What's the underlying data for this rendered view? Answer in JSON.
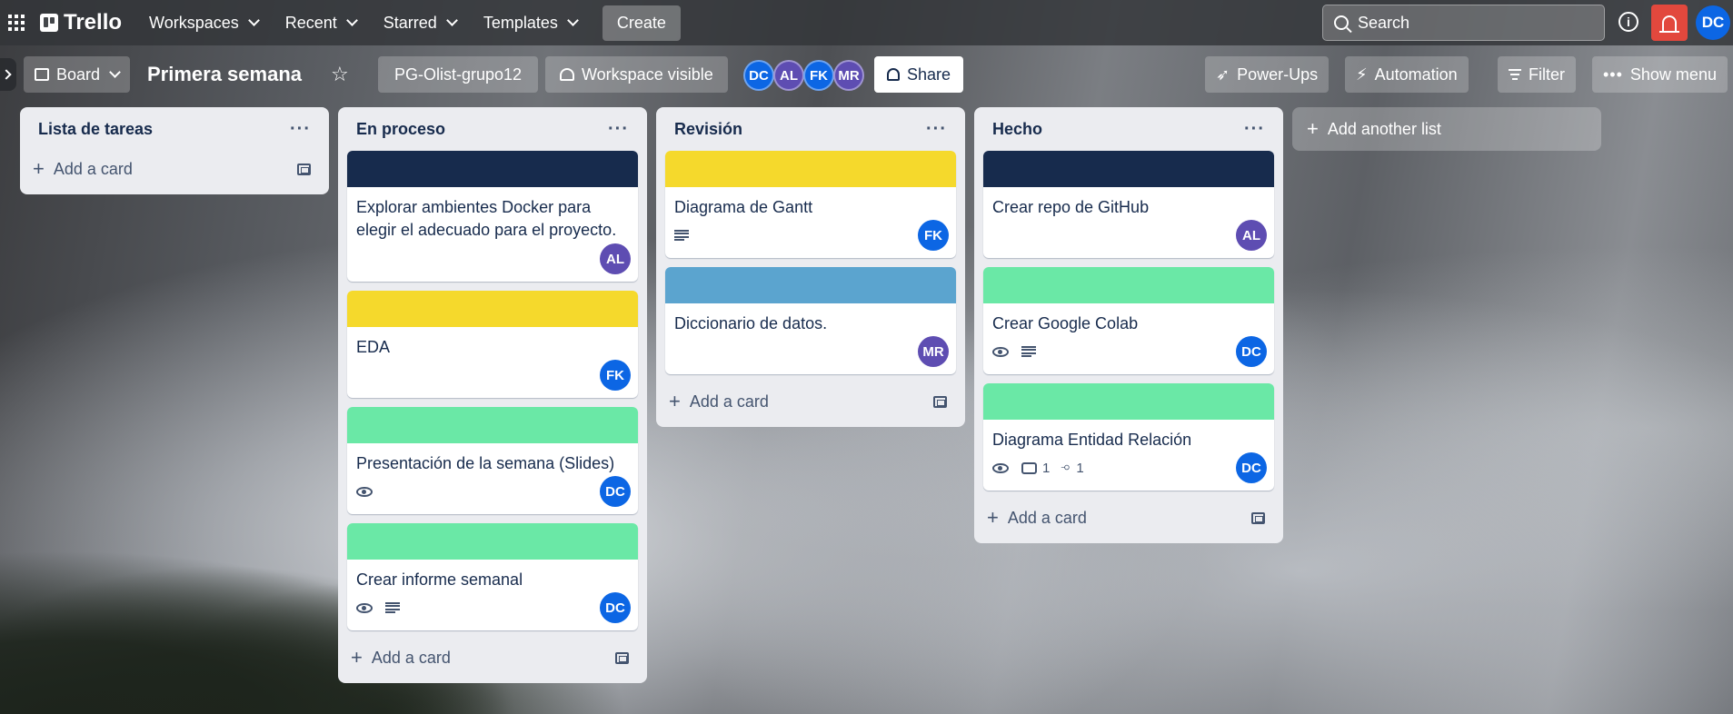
{
  "topnav": {
    "brand": "Trello",
    "menus": [
      "Workspaces",
      "Recent",
      "Starred",
      "Templates"
    ],
    "create_label": "Create",
    "search_placeholder": "Search",
    "user_initials": "DC"
  },
  "board": {
    "view_label": "Board",
    "title": "Primera semana",
    "workspace": "PG-Olist-grupo12",
    "visibility": "Workspace visible",
    "members": [
      {
        "initials": "DC",
        "color": "#0c66e4"
      },
      {
        "initials": "AL",
        "color": "#5e4db2"
      },
      {
        "initials": "FK",
        "color": "#0c66e4"
      },
      {
        "initials": "MR",
        "color": "#5e4db2"
      }
    ],
    "share_label": "Share",
    "powerups_label": "Power-Ups",
    "automation_label": "Automation",
    "filter_label": "Filter",
    "menu_label": "Show menu"
  },
  "lists": [
    {
      "title": "Lista de tareas",
      "add_label": "Add a card",
      "cards": []
    },
    {
      "title": "En proceso",
      "add_label": "Add a card",
      "cards": [
        {
          "title": "Explorar ambientes Docker para elegir el adecuado para el proyecto.",
          "cover": "#172b4d",
          "member": "AL",
          "member_color": "#5e4db2"
        },
        {
          "title": "EDA",
          "cover": "#f5d92c",
          "member": "FK",
          "member_color": "#0c66e4"
        },
        {
          "title": "Presentación de la semana (Slides)",
          "cover": "#6ae8a6",
          "member": "DC",
          "member_color": "#0c66e4",
          "watch": true
        },
        {
          "title": "Crear informe semanal",
          "cover": "#6ae8a6",
          "member": "DC",
          "member_color": "#0c66e4",
          "watch": true,
          "description": true
        }
      ]
    },
    {
      "title": "Revisión",
      "add_label": "Add a card",
      "cards": [
        {
          "title": "Diagrama de Gantt",
          "cover": "#f5d92c",
          "member": "FK",
          "member_color": "#0c66e4",
          "description": true
        },
        {
          "title": "Diccionario de datos.",
          "cover": "#5ba4cf",
          "member": "MR",
          "member_color": "#5e4db2"
        }
      ]
    },
    {
      "title": "Hecho",
      "add_label": "Add a card",
      "cards": [
        {
          "title": "Crear repo de GitHub",
          "cover": "#172b4d",
          "member": "AL",
          "member_color": "#5e4db2"
        },
        {
          "title": "Crear Google Colab",
          "cover": "#6ae8a6",
          "member": "DC",
          "member_color": "#0c66e4",
          "watch": true,
          "description": true
        },
        {
          "title": "Diagrama Entidad Relación",
          "cover": "#6ae8a6",
          "member": "DC",
          "member_color": "#0c66e4",
          "watch": true,
          "comments": "1",
          "attachments": "1"
        }
      ]
    }
  ],
  "add_list_label": "Add another list"
}
